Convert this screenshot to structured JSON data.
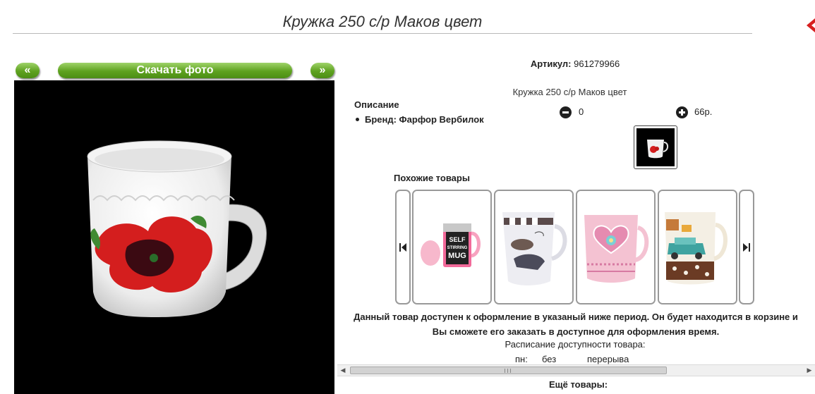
{
  "page_title": "Кружка 250 с/р Маков цвет",
  "gallery": {
    "prev_label": "«",
    "download_label": "Скачать фото",
    "next_label": "»"
  },
  "article": {
    "label": "Артикул:",
    "value": "961279966"
  },
  "description": {
    "title": "Описание",
    "brand": "Бренд: Фарфор Вербилок"
  },
  "variant": {
    "name": "Кружка 250 с/р Маков цвет",
    "quantity": "0",
    "price": "66р."
  },
  "similar": {
    "title": "Похожие товары",
    "items": [
      {
        "icon": "self-stirring-mug-image"
      },
      {
        "icon": "fashion-mug-image"
      },
      {
        "icon": "pink-heart-mug-image"
      },
      {
        "icon": "car-mug-image"
      }
    ],
    "self_stir_text": [
      "SELF",
      "STIRRING",
      "MUG"
    ]
  },
  "availability": {
    "notice": "Данный товар доступен к оформление в указаный ниже период. Он будет находится в корзине и Вы сможете его заказать в доступное для оформления время.",
    "schedule_label": "Расписание доступности товара:",
    "day": "пн:",
    "from": "без",
    "to": "перерыва"
  },
  "more_title": "Ещё товары:",
  "colors": {
    "green_button": "#5ea21f",
    "close_red": "#d71f1f",
    "photo_bg": "#000000"
  }
}
